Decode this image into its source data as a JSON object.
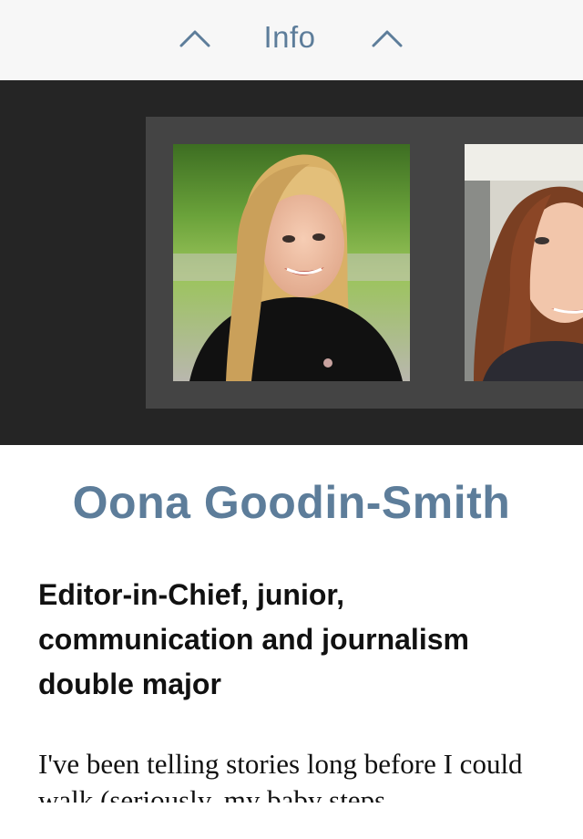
{
  "header": {
    "title": "Info",
    "prev_icon": "chevron-up-icon",
    "next_icon": "chevron-up-icon",
    "accent_color": "#5d7d9a"
  },
  "carousel": {
    "background": "#252525",
    "items": [
      {
        "photo": "portrait-photo",
        "description": "staff member portrait"
      },
      {
        "photo": "portrait-photo",
        "description": "staff member portrait"
      }
    ]
  },
  "profile": {
    "name": "Oona Goodin-Smith",
    "role": "Editor-in-Chief, junior, communication and journalism double major",
    "bio": "I've been telling stories long before I could walk (seriously, my baby steps"
  }
}
